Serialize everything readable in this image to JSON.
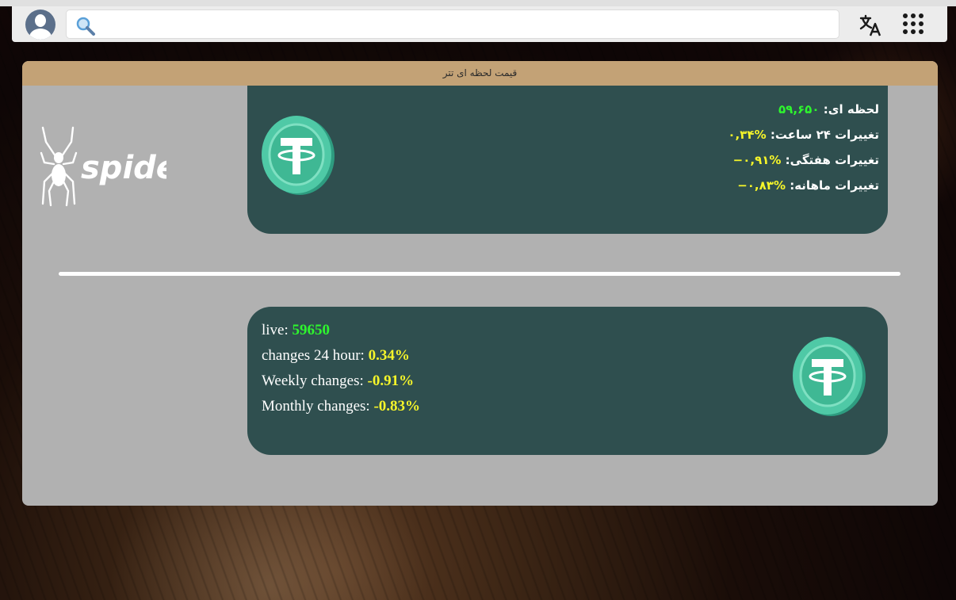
{
  "topbar": {
    "search": {
      "placeholder": "",
      "value": ""
    },
    "icons": {
      "avatar": "user-avatar-icon",
      "search": "search-icon",
      "translate": "translate-icon",
      "apps": "apps-grid-icon"
    }
  },
  "panel": {
    "header_title": "قیمت لحظه ای تتر",
    "logo_text": "spider",
    "farsi_card": {
      "live_label": "لحظه ای:",
      "live_value": "۵۹,۶۵۰",
      "change24_label": "تغییرات ۲۴ ساعت:",
      "change24_value": "%۰,۳۴",
      "weekly_label": "تغییرات هفتگی:",
      "weekly_value": "%۰,۹۱−",
      "monthly_label": "تغییرات ماهانه:",
      "monthly_value": "%۰,۸۳−"
    },
    "english_card": {
      "live_label": "live:",
      "live_value": "59650",
      "change24_label": "changes 24 hour:",
      "change24_value": "0.34%",
      "weekly_label": "Weekly changes:",
      "weekly_value": "-0.91%",
      "monthly_label": "Monthly changes:",
      "monthly_value": "-0.83%"
    },
    "coin_symbol": "T"
  },
  "colors": {
    "header_bg": "#c3a276",
    "panel_bg": "#b1b1b1",
    "card_bg": "#2f4f4f",
    "value_green": "#2ef52e",
    "value_yellow": "#f5f52a",
    "coin_teal": "#4fc9a6"
  }
}
